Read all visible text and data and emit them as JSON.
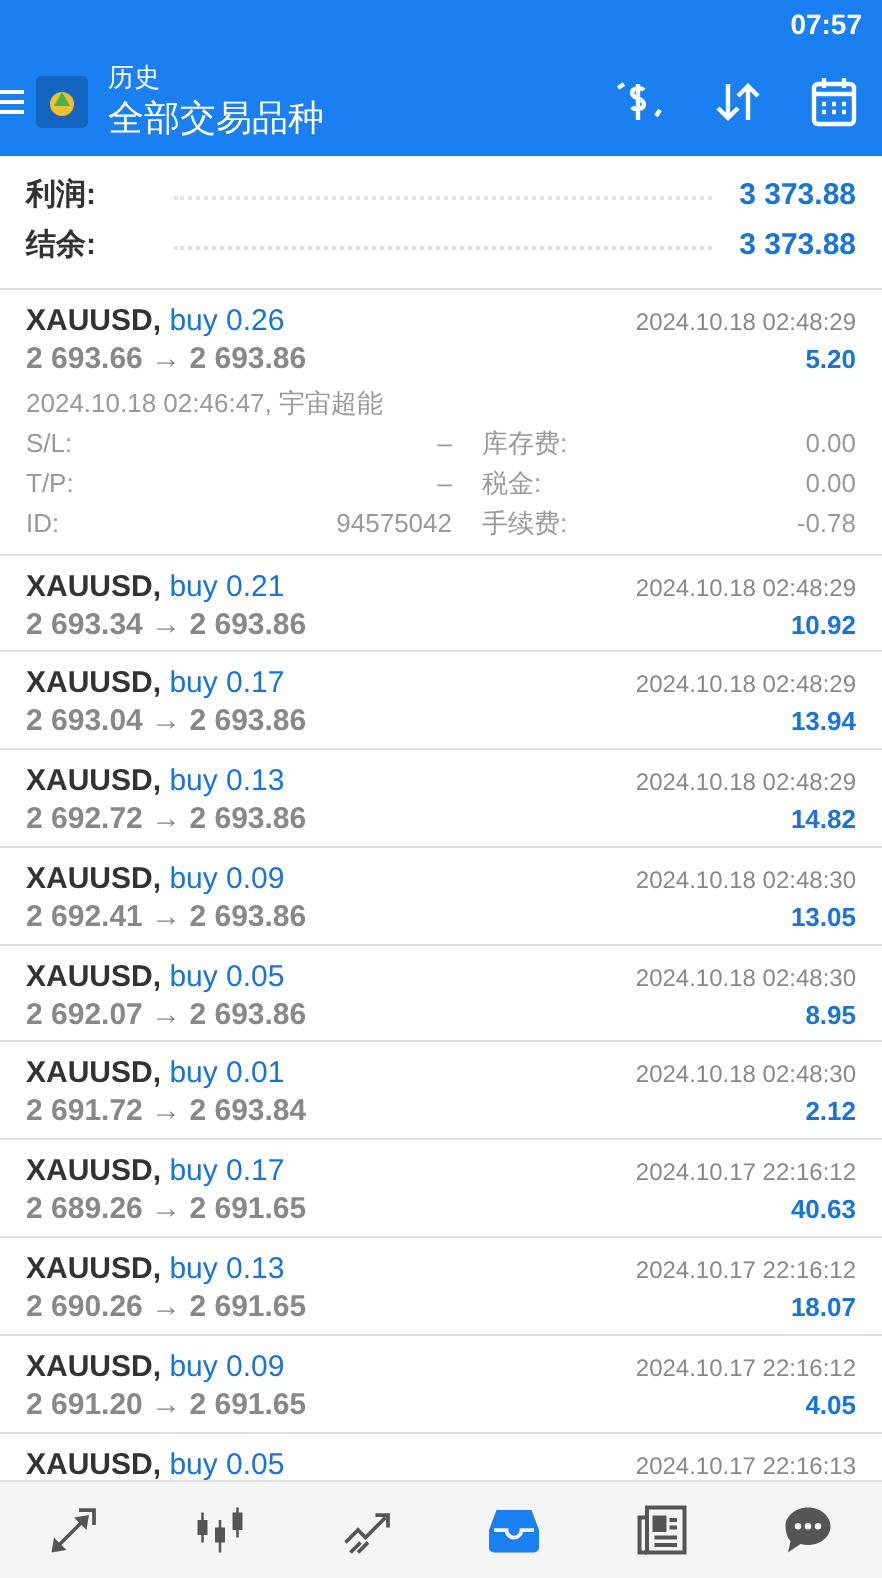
{
  "status_bar": {
    "time": "07:57"
  },
  "app_bar": {
    "subtitle": "历史",
    "title": "全部交易品种"
  },
  "summary": [
    {
      "label": "利润:",
      "value": "3 373.88"
    },
    {
      "label": "结余:",
      "value": "3 373.88"
    }
  ],
  "deals": [
    {
      "symbol": "XAUUSD,",
      "side": "buy 0.26",
      "prices": "2 693.66 → 2 693.86",
      "time": "2024.10.18 02:48:29",
      "profit": "5.20",
      "expanded": true,
      "details": {
        "open": "2024.10.18 02:46:47, 宇宙超能",
        "rows": [
          {
            "label": "S/L:",
            "value": "–",
            "label2": "库存费:",
            "value2": "0.00"
          },
          {
            "label": "T/P:",
            "value": "–",
            "label2": "税金:",
            "value2": "0.00"
          },
          {
            "label": "ID:",
            "value": "94575042",
            "label2": "手续费:",
            "value2": "-0.78"
          }
        ]
      }
    },
    {
      "symbol": "XAUUSD,",
      "side": "buy 0.21",
      "prices": "2 693.34 → 2 693.86",
      "time": "2024.10.18 02:48:29",
      "profit": "10.92",
      "expanded": false
    },
    {
      "symbol": "XAUUSD,",
      "side": "buy 0.17",
      "prices": "2 693.04 → 2 693.86",
      "time": "2024.10.18 02:48:29",
      "profit": "13.94",
      "expanded": false
    },
    {
      "symbol": "XAUUSD,",
      "side": "buy 0.13",
      "prices": "2 692.72 → 2 693.86",
      "time": "2024.10.18 02:48:29",
      "profit": "14.82",
      "expanded": false
    },
    {
      "symbol": "XAUUSD,",
      "side": "buy 0.09",
      "prices": "2 692.41 → 2 693.86",
      "time": "2024.10.18 02:48:30",
      "profit": "13.05",
      "expanded": false
    },
    {
      "symbol": "XAUUSD,",
      "side": "buy 0.05",
      "prices": "2 692.07 → 2 693.86",
      "time": "2024.10.18 02:48:30",
      "profit": "8.95",
      "expanded": false
    },
    {
      "symbol": "XAUUSD,",
      "side": "buy 0.01",
      "prices": "2 691.72 → 2 693.84",
      "time": "2024.10.18 02:48:30",
      "profit": "2.12",
      "expanded": false
    },
    {
      "symbol": "XAUUSD,",
      "side": "buy 0.17",
      "prices": "2 689.26 → 2 691.65",
      "time": "2024.10.17 22:16:12",
      "profit": "40.63",
      "expanded": false
    },
    {
      "symbol": "XAUUSD,",
      "side": "buy 0.13",
      "prices": "2 690.26 → 2 691.65",
      "time": "2024.10.17 22:16:12",
      "profit": "18.07",
      "expanded": false
    },
    {
      "symbol": "XAUUSD,",
      "side": "buy 0.09",
      "prices": "2 691.20 → 2 691.65",
      "time": "2024.10.17 22:16:12",
      "profit": "4.05",
      "expanded": false
    },
    {
      "symbol": "XAUUSD,",
      "side": "buy 0.05",
      "time": "2024.10.17 22:16:13",
      "expanded": false
    }
  ],
  "bottom_nav": [
    {
      "kind": "quotes",
      "selected": false
    },
    {
      "kind": "chart",
      "selected": false
    },
    {
      "kind": "trade",
      "selected": false
    },
    {
      "kind": "history",
      "selected": true
    },
    {
      "kind": "news",
      "selected": false
    },
    {
      "kind": "chat",
      "selected": false
    }
  ]
}
